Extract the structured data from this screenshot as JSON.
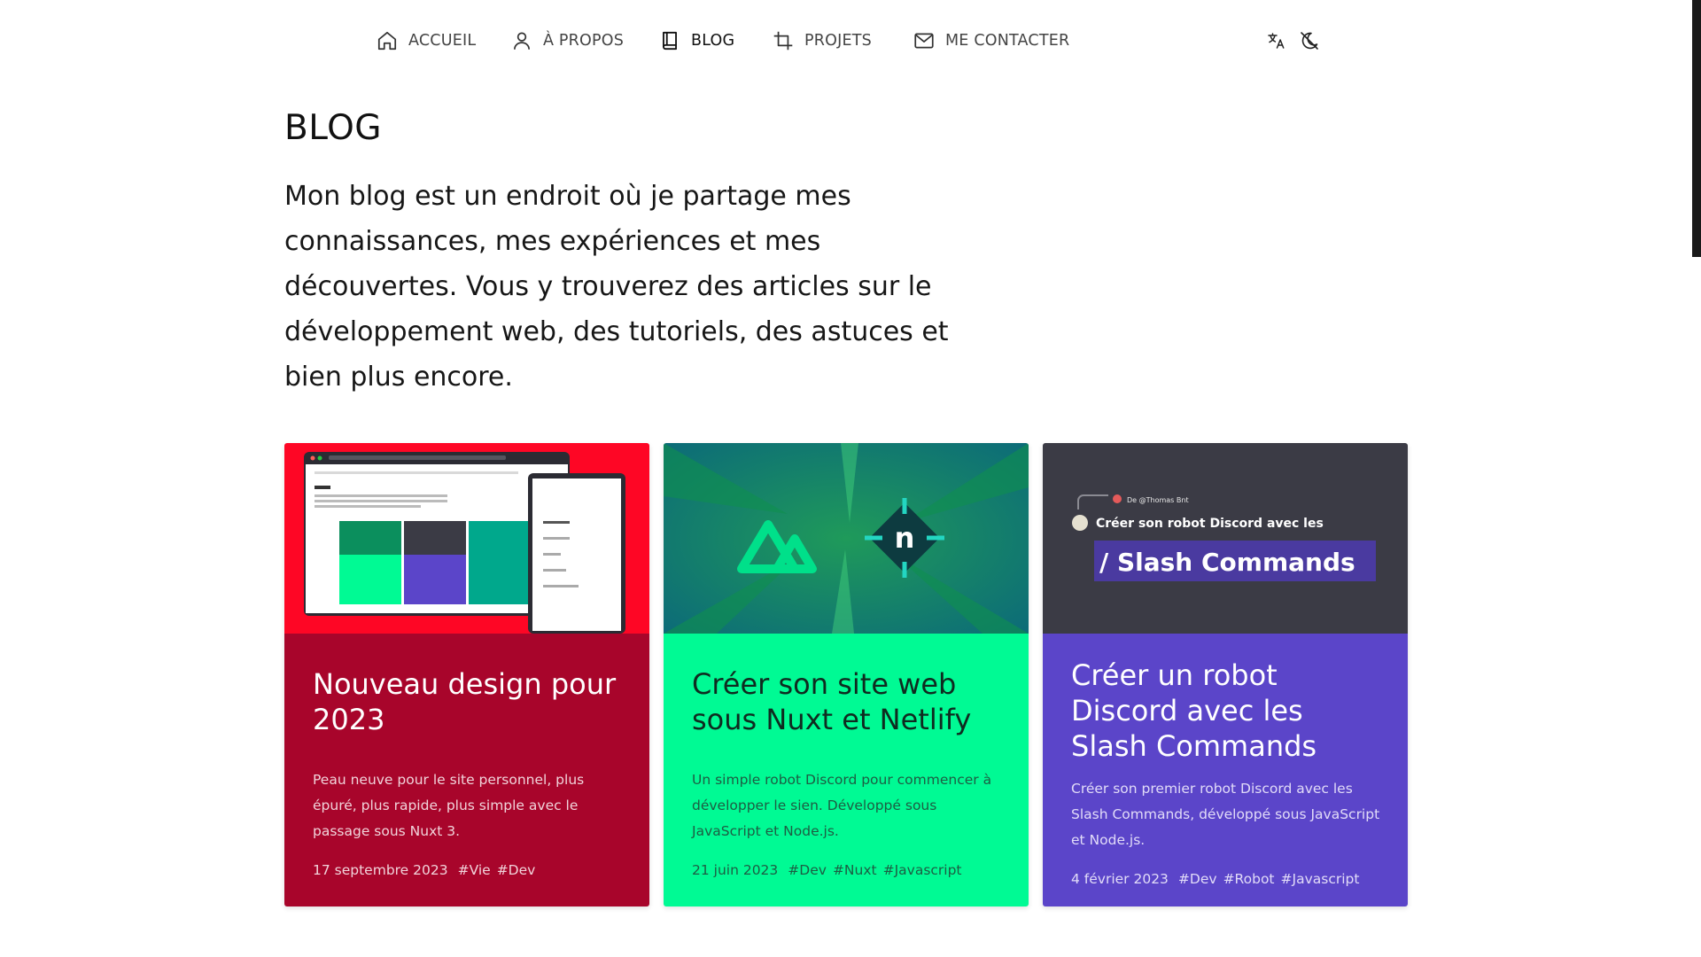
{
  "colors": {
    "accent_red": "#a8052b",
    "accent_green": "#00fa94",
    "accent_purple": "#5b45c9",
    "image_red": "#fe0625",
    "image_dark": "#3b3b45"
  },
  "nav": {
    "items": [
      {
        "label": "ACCUEIL",
        "icon": "home-icon"
      },
      {
        "label": "À PROPOS",
        "icon": "user-icon"
      },
      {
        "label": "BLOG",
        "icon": "book-icon",
        "active": true
      },
      {
        "label": "PROJETS",
        "icon": "crop-icon"
      },
      {
        "label": "ME CONTACTER",
        "icon": "mail-icon"
      }
    ],
    "tools": [
      {
        "icon": "translate-icon"
      },
      {
        "icon": "theme-toggle-icon"
      }
    ]
  },
  "page": {
    "title": "BLOG",
    "intro": "Mon blog est un endroit où je partage mes connaissances, mes expériences et mes découvertes. Vous y trouverez des articles sur le développement web, des tutoriels, des astuces et bien plus encore."
  },
  "cards": [
    {
      "title": "Nouveau design pour 2023",
      "description": "Peau neuve pour le site personnel, plus épuré, plus rapide, plus simple avec le passage sous Nuxt 3.",
      "date": "17 septembre 2023",
      "tags": [
        "#Vie",
        "#Dev"
      ]
    },
    {
      "title": "Créer son site web sous Nuxt et Netlify",
      "description": "Un simple robot Discord pour commencer à développer le sien. Développé sous JavaScript et Node.js.",
      "date": "21 juin 2023",
      "tags": [
        "#Dev",
        "#Nuxt",
        "#Javascript"
      ]
    },
    {
      "title": "Créer un robot Discord avec les Slash Commands",
      "description": "Créer son premier robot Discord avec les Slash Commands, développé sous JavaScript et Node.js.",
      "date": "4 février 2023",
      "tags": [
        "#Dev",
        "#Robot",
        "#Javascript"
      ],
      "image": {
        "reply_label": "De @Thomas Bnt",
        "heading": "Créer son robot Discord avec les",
        "highlight": "/ Slash Commands"
      }
    }
  ]
}
